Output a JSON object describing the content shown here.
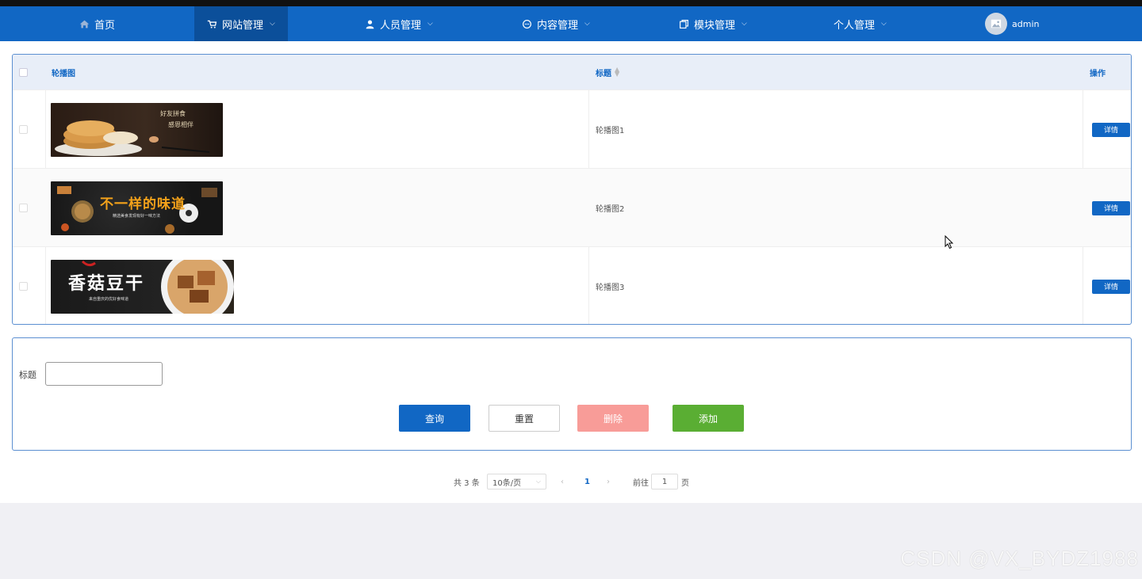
{
  "nav": {
    "items": [
      {
        "label": "首页",
        "icon": "home-icon"
      },
      {
        "label": "网站管理",
        "icon": "cart-icon",
        "active": true
      },
      {
        "label": "人员管理",
        "icon": "user-icon"
      },
      {
        "label": "内容管理",
        "icon": "chat-icon"
      },
      {
        "label": "模块管理",
        "icon": "copy-icon"
      },
      {
        "label": "个人管理",
        "icon": ""
      }
    ],
    "user": "admin"
  },
  "table": {
    "headers": {
      "image": "轮播图",
      "title": "标题",
      "action": "操作"
    },
    "rows": [
      {
        "title": "轮播图1",
        "action": "详情",
        "banner_text_a": "好友拼食",
        "banner_text_b": "感恩相伴"
      },
      {
        "title": "轮播图2",
        "action": "详情",
        "banner_text_a": "不一样的味道",
        "banner_text_b": "精选美食发现有好一味方法"
      },
      {
        "title": "轮播图3",
        "action": "详情",
        "banner_text_a": "香菇豆干",
        "banner_text_b": "来自重庆的优好食味道"
      }
    ]
  },
  "search": {
    "label": "标题",
    "value": "",
    "buttons": {
      "query": "查询",
      "reset": "重置",
      "delete": "删除",
      "add": "添加"
    }
  },
  "pagination": {
    "total": "共 3 条",
    "page_size": "10条/页",
    "current": "1",
    "goto_label": "前往",
    "goto_value": "1",
    "page_suffix": "页"
  },
  "watermark": "CSDN @VX_BYDZ1988",
  "colors": {
    "primary": "#1167c4",
    "delete": "#f89c98",
    "add": "#5aae33"
  }
}
